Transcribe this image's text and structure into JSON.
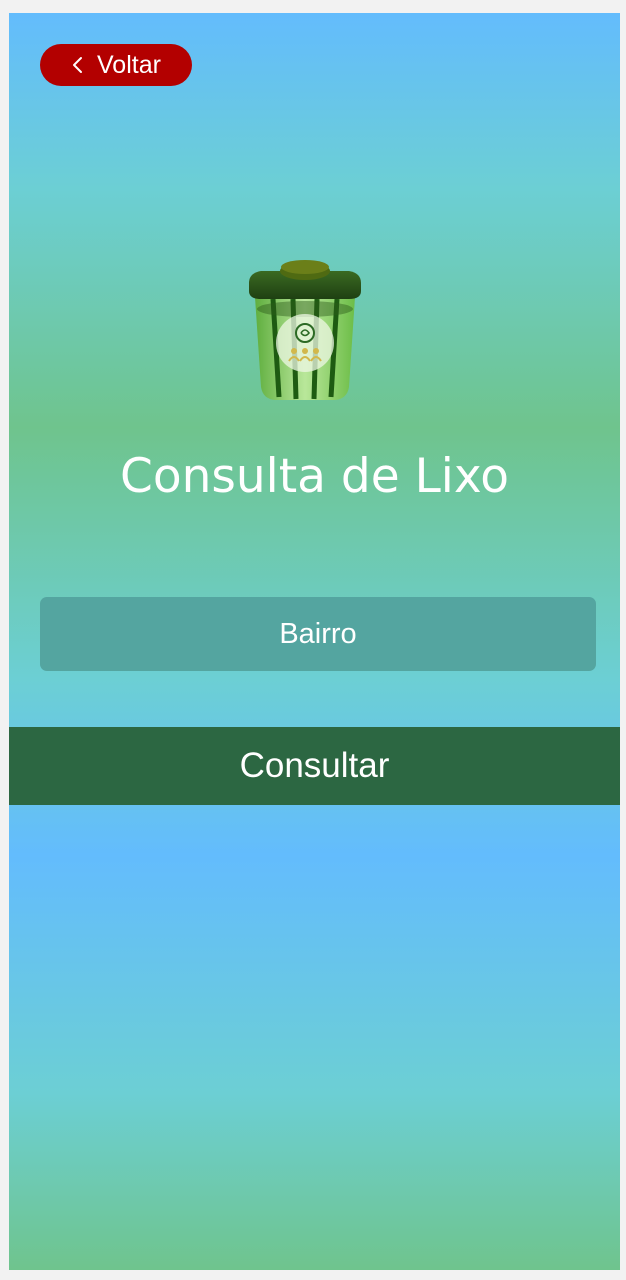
{
  "header": {
    "back_label": "Voltar",
    "back_icon": "chevron-left-icon",
    "back_color": "#b30000"
  },
  "logo": {
    "icon": "trash-bin-icon"
  },
  "main": {
    "title": "Consulta de Lixo",
    "neighborhood_placeholder": "Bairro",
    "submit_label": "Consultar",
    "submit_color": "#2c6742"
  }
}
